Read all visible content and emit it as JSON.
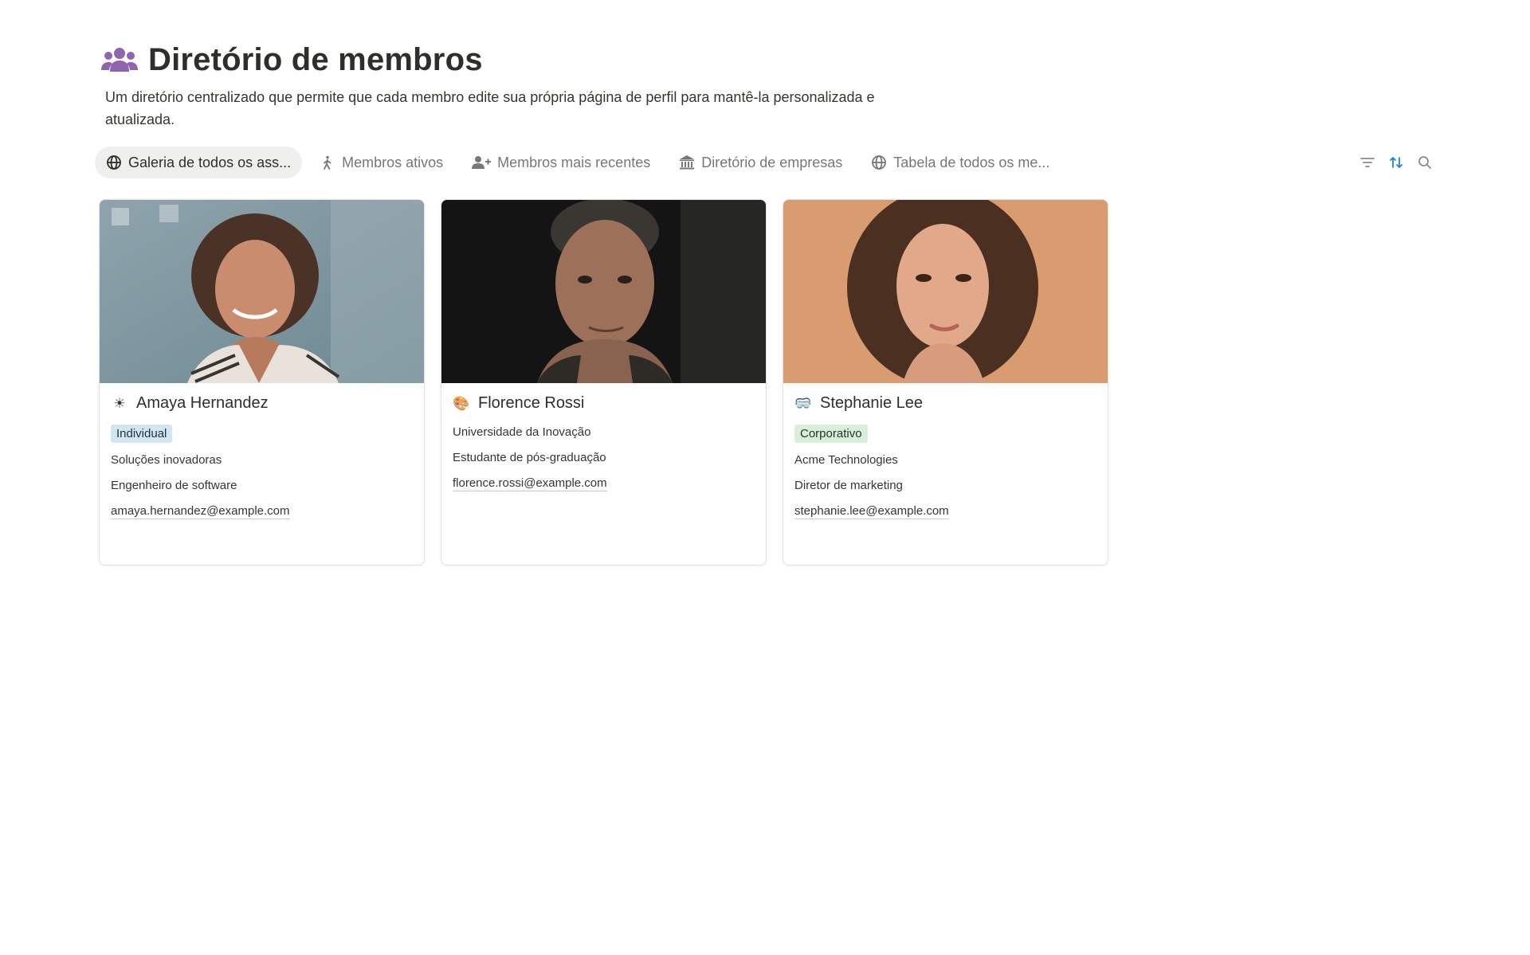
{
  "header": {
    "icon": "people-group-icon",
    "icon_color": "#9065b0",
    "title": "Diretório de membros",
    "description": "Um diretório centralizado que permite que cada membro edite sua própria página de perfil para mantê-la personalizada e atualizada."
  },
  "tabs": [
    {
      "label": "Galeria de todos os ass...",
      "icon": "globe-icon",
      "active": true
    },
    {
      "label": "Membros ativos",
      "icon": "walking-person-icon",
      "active": false
    },
    {
      "label": "Membros mais recentes",
      "icon": "add-person-icon",
      "active": false
    },
    {
      "label": "Diretório de empresas",
      "icon": "bank-icon",
      "active": false
    },
    {
      "label": "Tabela de todos os me...",
      "icon": "globe-icon",
      "active": false
    }
  ],
  "tools": [
    {
      "icon": "filter-icon"
    },
    {
      "icon": "sort-icon",
      "color": "#2383e2"
    },
    {
      "icon": "search-icon"
    }
  ],
  "cards": [
    {
      "emoji": "☀",
      "name": "Amaya Hernandez",
      "tag": "Individual",
      "tag_bg": "#d3e5ef",
      "tag_color": "#183347",
      "fields": [
        "Soluções inovadoras",
        "Engenheiro de software"
      ],
      "email": "amaya.hernandez@example.com"
    },
    {
      "emoji": "🎨",
      "name": "Florence Rossi",
      "tag": "",
      "fields": [
        "Universidade da Inovação",
        "Estudante de pós-graduação"
      ],
      "email": "florence.rossi@example.com"
    },
    {
      "emoji": "🥽",
      "name": "Stephanie Lee",
      "tag": "Corporativo",
      "tag_bg": "#dbeddb",
      "tag_color": "#1c3829",
      "fields": [
        "Acme Technologies",
        "Diretor de marketing"
      ],
      "email": "stephanie.lee@example.com"
    }
  ]
}
